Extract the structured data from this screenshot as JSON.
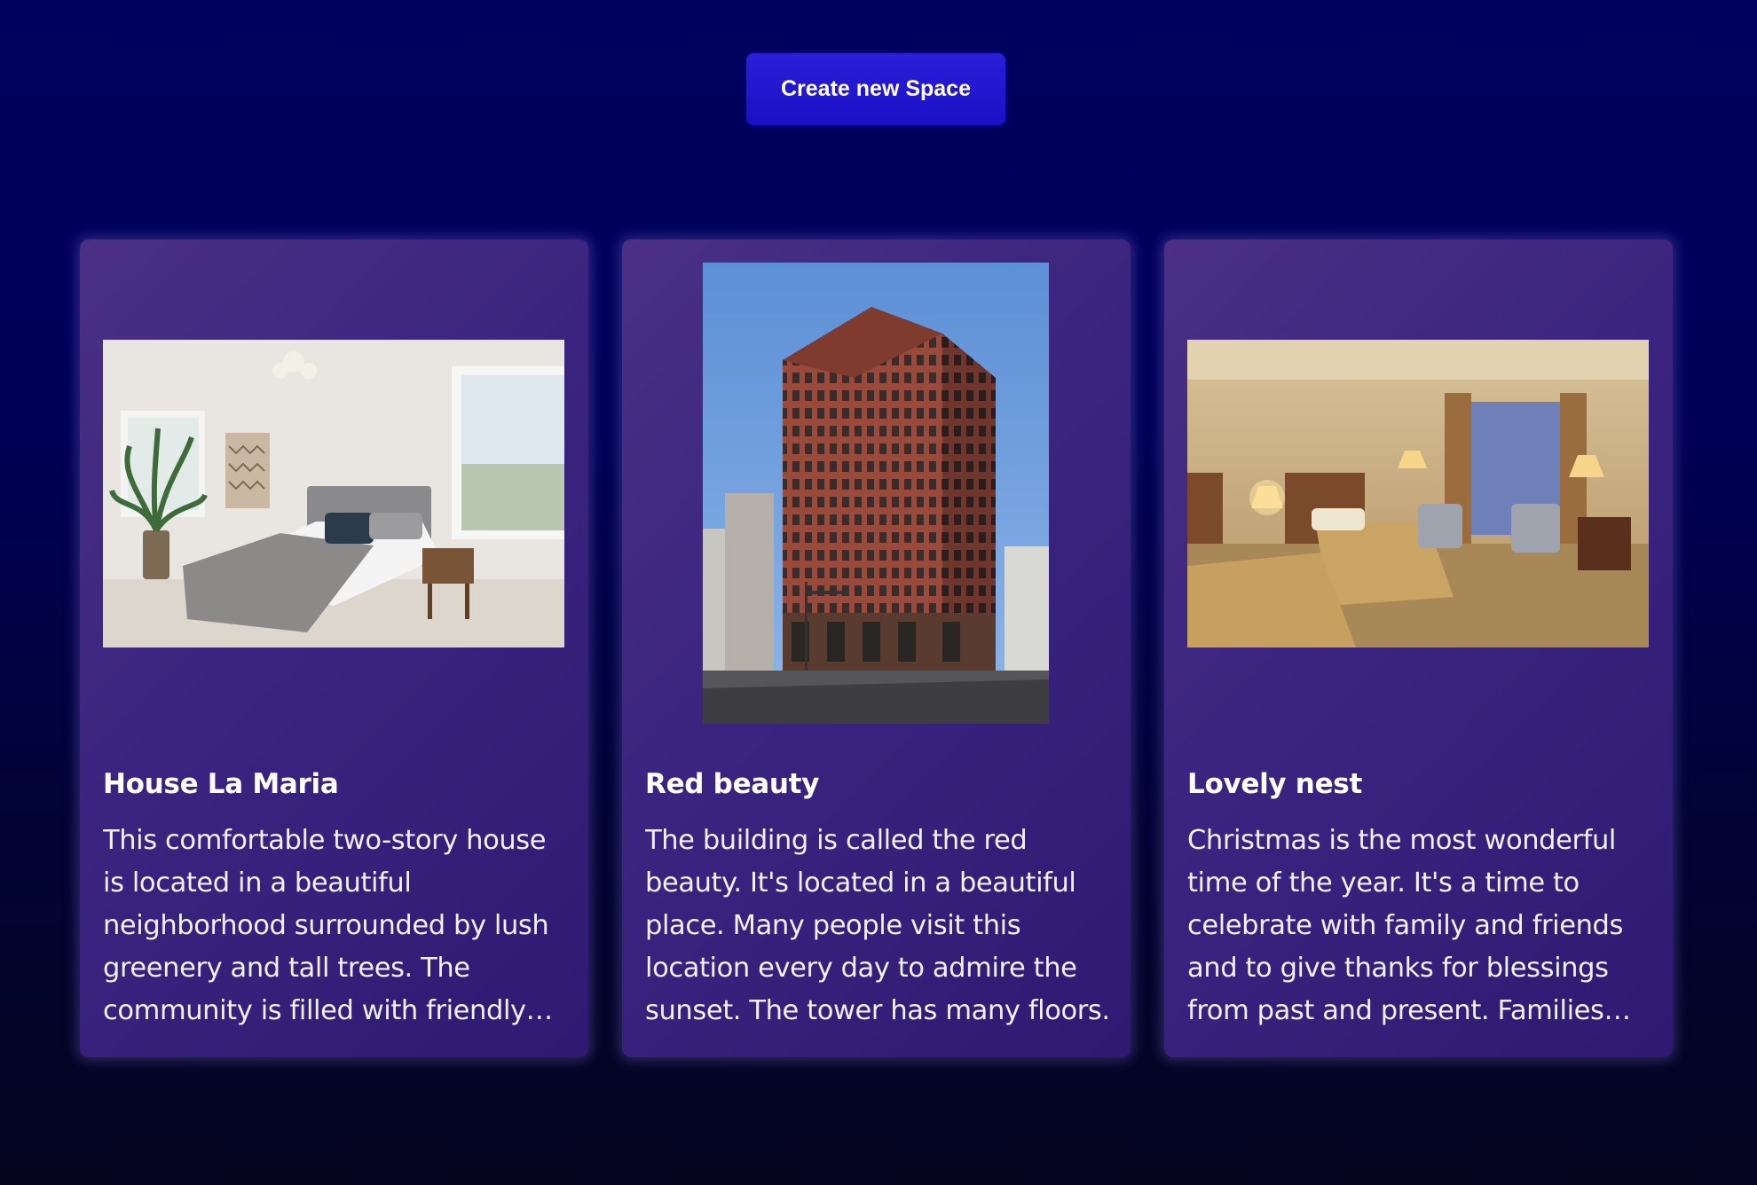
{
  "toolbar": {
    "create_label": "Create new Space"
  },
  "spaces": [
    {
      "title": "House La Maria",
      "description": "This comfortable two-story house is located in a beautiful neighborhood surrounded by lush greenery and tall trees. The community is filled with friendly neighbors.",
      "image": "bedroom-photo"
    },
    {
      "title": "Red beauty",
      "description": "The building is called the red beauty. It's located in a beautiful place. Many people visit this location every day to admire the sunset. The tower has many floors.",
      "image": "red-brick-building-photo"
    },
    {
      "title": "Lovely nest",
      "description": "Christmas is the most wonderful time of the year. It's a time to celebrate with family and friends and to give thanks for blessings from past and present. Families gather together.",
      "image": "hotel-room-photo"
    }
  ],
  "colors": {
    "background": "#000058",
    "button": "#2a1ed8",
    "card": "#3a2480"
  }
}
